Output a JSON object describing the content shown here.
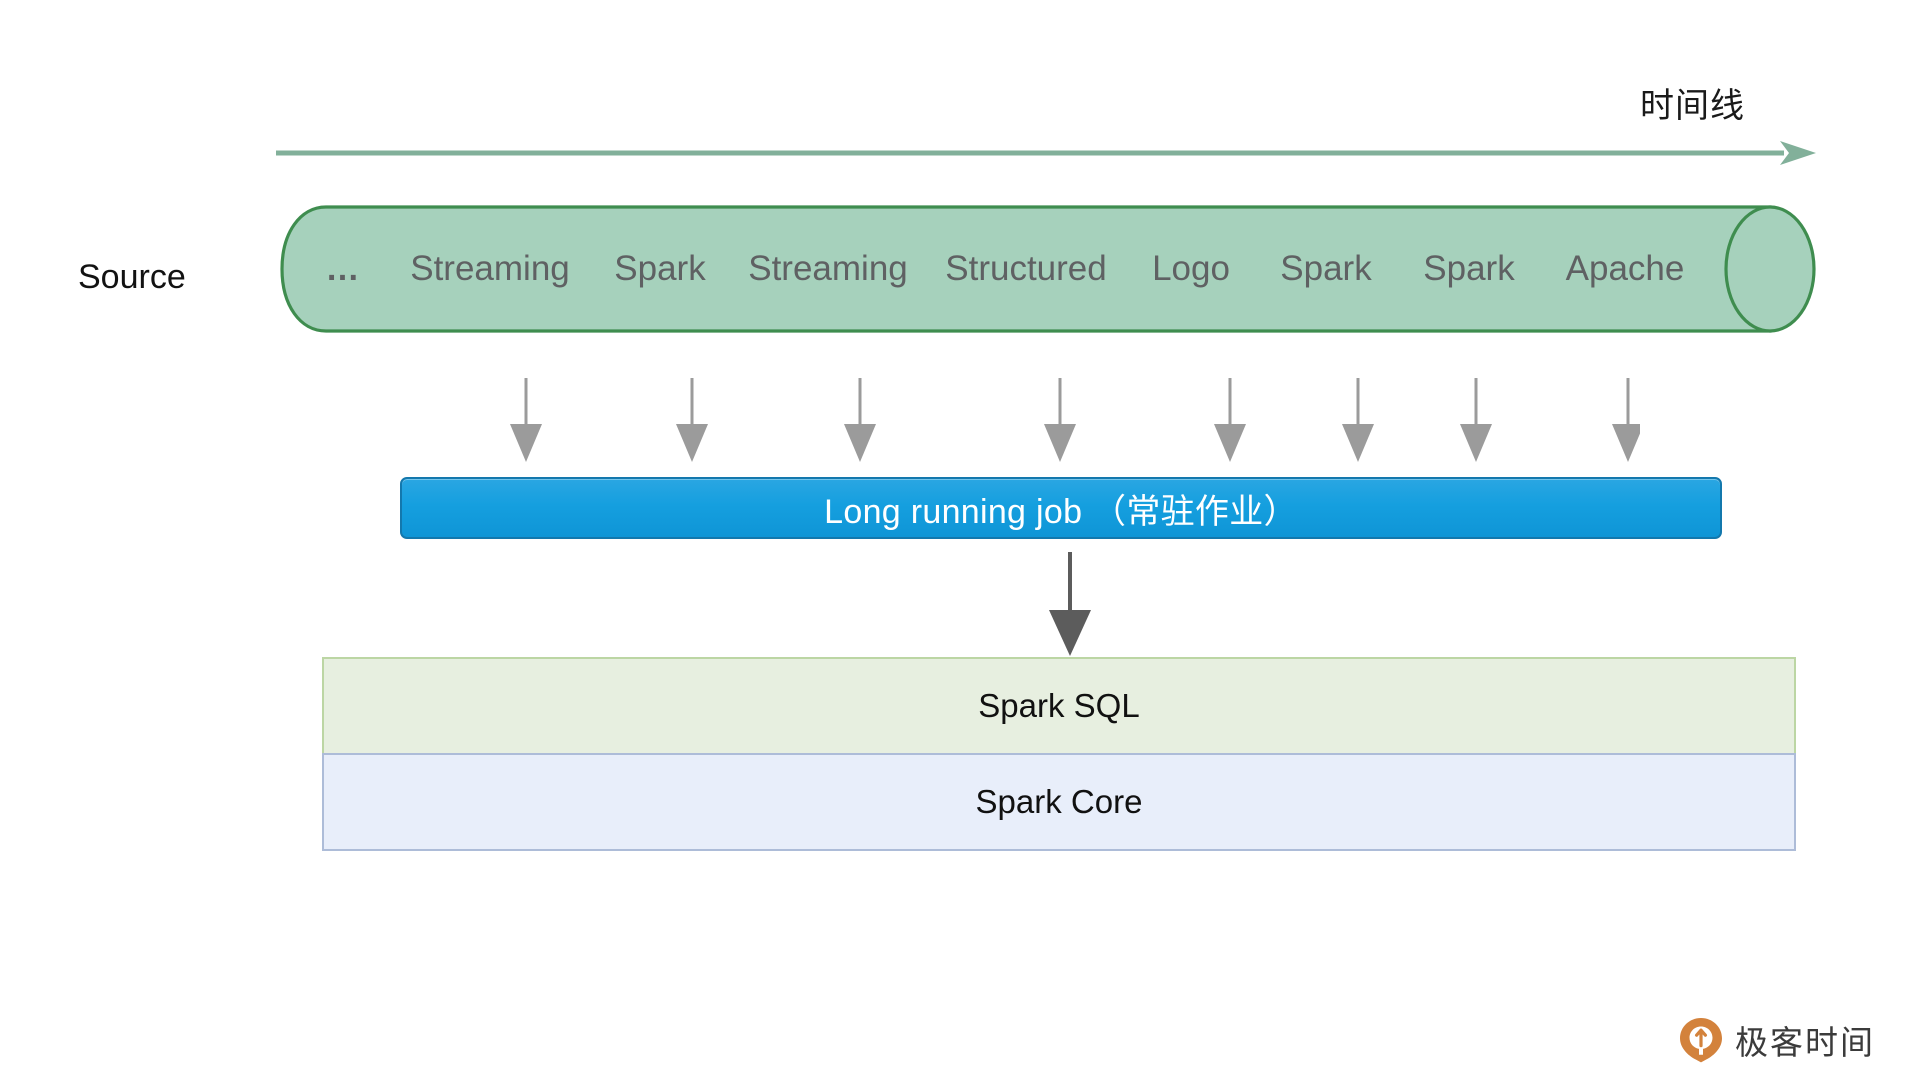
{
  "timeline": {
    "label": "时间线",
    "arrow_color": "#7aab94",
    "arrow_icon": "right-arrow-icon"
  },
  "source": {
    "label": "Source",
    "cylinder": {
      "fill_color": "#a6d1bc",
      "stroke_color": "#3f8d4f",
      "items": [
        {
          "label": "…",
          "kind": "ellipsis"
        },
        {
          "label": "Streaming"
        },
        {
          "label": "Spark"
        },
        {
          "label": "Streaming"
        },
        {
          "label": "Structured"
        },
        {
          "label": "Logo"
        },
        {
          "label": "Spark"
        },
        {
          "label": "Spark"
        },
        {
          "label": "Apache"
        }
      ]
    }
  },
  "feed_arrows": {
    "icon": "down-arrow-icon",
    "count": 8,
    "color": "#9b9b9b"
  },
  "job": {
    "label": "Long running job （常驻作业）",
    "fill_color": "#139FDF",
    "border_color": "#1378ad",
    "text_color": "#ffffff"
  },
  "stack_arrow": {
    "icon": "down-arrow-icon",
    "color": "#5c5c5c"
  },
  "stack": {
    "layers": [
      {
        "label": "Spark SQL",
        "fill_color": "#e7efe0",
        "border_color": "#bcd6a4"
      },
      {
        "label": "Spark Core",
        "fill_color": "#e8eefa",
        "border_color": "#adbcd8"
      }
    ]
  },
  "brand": {
    "name": "极客时间",
    "mark_icon": "geektime-pin-logo-icon",
    "mark_color": "#D3823C"
  }
}
